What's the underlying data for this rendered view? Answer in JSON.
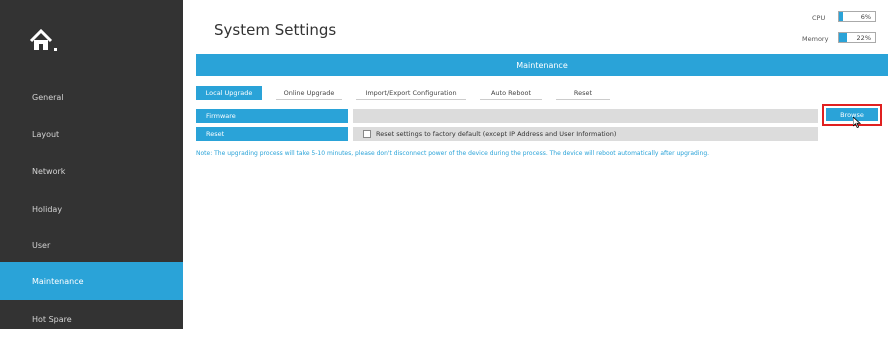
{
  "header": {
    "title": "System Settings"
  },
  "stats": {
    "cpu": {
      "label": "CPU",
      "value": "6%",
      "fraction": 0.06
    },
    "memory": {
      "label": "Memory",
      "value": "22%",
      "fraction": 0.22
    }
  },
  "sidebar": {
    "home_icon": "home-icon",
    "items": [
      {
        "label": "General"
      },
      {
        "label": "Layout"
      },
      {
        "label": "Network"
      },
      {
        "label": "Holiday"
      },
      {
        "label": "User"
      },
      {
        "label": "Maintenance",
        "active": true
      },
      {
        "label": "Hot Spare"
      }
    ]
  },
  "main": {
    "section_title": "Maintenance",
    "tabs": [
      {
        "label": "Local Upgrade",
        "active": true
      },
      {
        "label": "Online Upgrade"
      },
      {
        "label": "Import/Export Configuration"
      },
      {
        "label": "Auto Reboot"
      },
      {
        "label": "Reset"
      }
    ],
    "firmware": {
      "label": "Firmware",
      "value": "",
      "browse_label": "Browse"
    },
    "reset": {
      "label": "Reset",
      "checkbox_text": "Reset settings to factory default (except IP Address and User Information)",
      "checked": false
    },
    "note": "Note: The upgrading process will take 5-10 minutes, please don't disconnect power of the device during the process. The device will reboot automatically after upgrading."
  },
  "colors": {
    "accent": "#2aa3d8",
    "sidebar": "#333333",
    "highlight": "#e02020"
  }
}
